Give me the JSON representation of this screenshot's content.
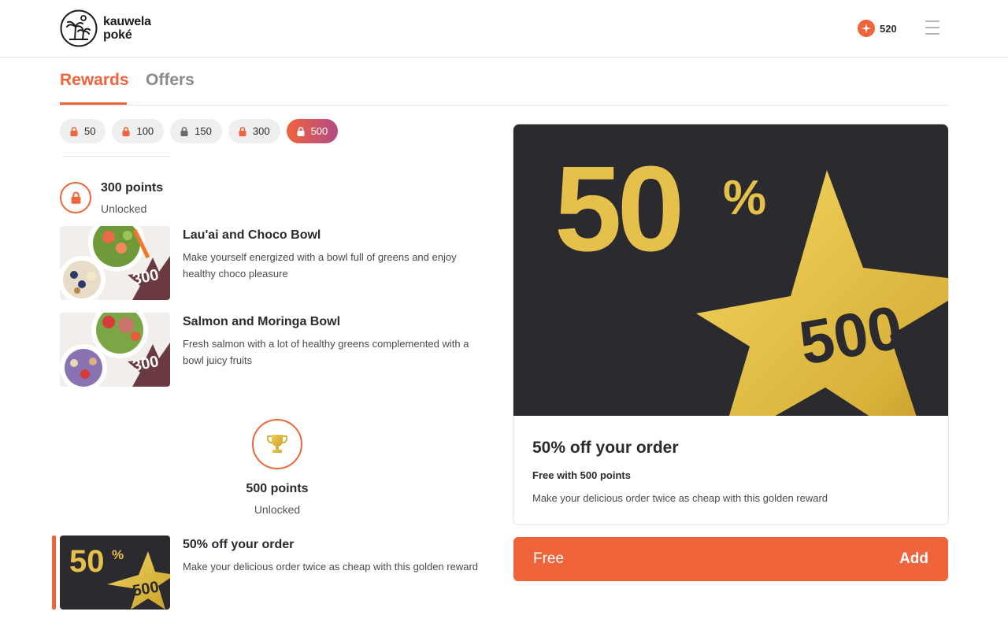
{
  "brand": {
    "name_line1": "kauwela",
    "name_line2": "poké"
  },
  "header": {
    "points": "520"
  },
  "tabs": [
    {
      "label": "Rewards",
      "active": true
    },
    {
      "label": "Offers",
      "active": false
    }
  ],
  "filters": [
    {
      "label": "50",
      "locked_color": "#f0643c",
      "active": false
    },
    {
      "label": "100",
      "locked_color": "#f0643c",
      "active": false
    },
    {
      "label": "150",
      "locked_color": "#6b6b6b",
      "active": false
    },
    {
      "label": "300",
      "locked_color": "#f0643c",
      "active": false
    },
    {
      "label": "500",
      "locked_color": "#ffffff",
      "active": true
    }
  ],
  "tiers": [
    {
      "title": "300 points",
      "status": "Unlocked",
      "icon": "lock-icon",
      "items": [
        {
          "title": "Lau'ai and Choco Bowl",
          "description": "Make yourself energized with a bowl full of greens and enjoy healthy choco pleasure",
          "badge": "300"
        },
        {
          "title": "Salmon and Moringa Bowl",
          "description": "Fresh salmon with a lot of healthy greens complemented with a bowl juicy fruits",
          "badge": "300"
        }
      ]
    },
    {
      "title": "500 points",
      "status": "Unlocked",
      "icon": "trophy-icon",
      "items": [
        {
          "title": "50% off your order",
          "description": "Make your delicious order twice as cheap with this golden reward",
          "badge": "500",
          "big": "50",
          "pct": "%"
        }
      ]
    }
  ],
  "detail": {
    "big": "50",
    "pct": "%",
    "badge": "500",
    "title": "50% off your order",
    "cost": "Free with 500 points",
    "description": "Make your delicious order twice as cheap with this golden reward"
  },
  "action": {
    "price_label": "Free",
    "button_label": "Add"
  },
  "colors": {
    "accent": "#f0643c",
    "dark": "#2b2a2f",
    "gold": "#e5c04a",
    "burgundy": "#6b3a40"
  }
}
